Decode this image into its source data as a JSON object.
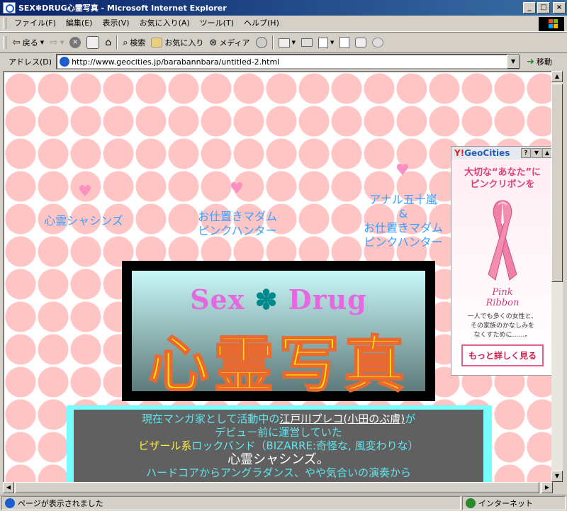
{
  "window": {
    "title": "SEX✽DRUG心霊写真 - Microsoft Internet Explorer",
    "minimize": "_",
    "maximize": "□",
    "close": "×"
  },
  "menu": [
    "ファイル(F)",
    "編集(E)",
    "表示(V)",
    "お気に入り(A)",
    "ツール(T)",
    "ヘルプ(H)"
  ],
  "toolbar": {
    "back": "戻る",
    "search": "検索",
    "favorites": "お気に入り",
    "media": "メディア"
  },
  "address": {
    "label": "アドレス(D)",
    "url": "http://www.geocities.jp/barabannbara/untitled-2.html",
    "go": "移動"
  },
  "page": {
    "nav": [
      {
        "lines": [
          "心霊シャシンズ"
        ]
      },
      {
        "lines": [
          "お仕置きマダム",
          "ピンクハンター"
        ]
      },
      {
        "lines": [
          "アナル五十嵐",
          "&",
          "お仕置きマダム",
          "ピンクハンター"
        ]
      }
    ],
    "banner": {
      "word1": "Sex",
      "star": "✽",
      "word2": "Drug",
      "kanji": "心霊写真"
    },
    "description": {
      "line1_pre": "現在マンガ家として活動中の",
      "line1_link": "江戸川プレコ(小田のぶ膚)",
      "line1_post": "が",
      "line2": "デビュー前に運営していた",
      "line3_pre": "ビザール系",
      "line3_post": "ロックバンド（BIZARRE:奇怪な, 風変わりな）",
      "line4": "心霊シャシンズ。",
      "line5": "ハードコアからアングラダンス、やや気合いの演奏から"
    }
  },
  "ad": {
    "brand_y": "Y!",
    "brand_name": "GeoCities",
    "help": "?",
    "headline1": "大切な“あなた”に",
    "headline2": "ピンクリボンを",
    "pink1": "Pink",
    "pink2": "Ribbon",
    "copy1": "一人でも多くの女性と、",
    "copy2": "その家族のかなしみを",
    "copy3": "なくすために……。",
    "more": "もっと詳しく見る"
  },
  "status": {
    "text": "ページが表示されました",
    "zone": "インターネット"
  }
}
